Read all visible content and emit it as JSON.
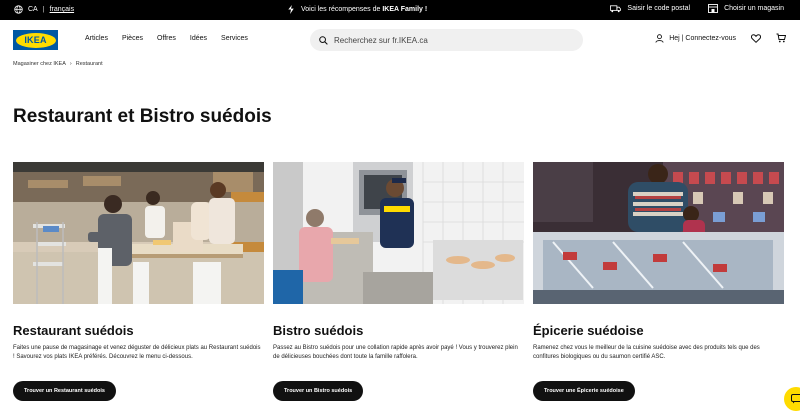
{
  "topbar": {
    "country": "CA",
    "language": "français",
    "promo_prefix": "Voici les récompenses de",
    "promo_brand": "IKEA Family !",
    "postal_label": "Saisir le code postal",
    "store_label": "Choisir un magasin"
  },
  "header": {
    "logo_text": "IKEA",
    "nav": [
      "Articles",
      "Pièces",
      "Offres",
      "Idées",
      "Services"
    ],
    "search_placeholder": "Recherchez sur fr.IKEA.ca",
    "account_label": "Hej | Connectez-vous"
  },
  "breadcrumb": [
    "Magasiner chez IKEA",
    "Restaurant"
  ],
  "page_title": "Restaurant et Bistro suédois",
  "cards": [
    {
      "title": "Restaurant suédois",
      "text": "Faites une pause de magasinage et venez déguster de délicieux plats au Restaurant suédois ! Savourez vos plats IKEA préférés. Découvrez le menu ci-dessous.",
      "button": "Trouver un Restaurant suédois"
    },
    {
      "title": "Bistro suédois",
      "text": "Passez au Bistro suédois pour une collation rapide après avoir payé ! Vous y trouverez plein de délicieuses bouchées dont toute la famille raffolera.",
      "button": "Trouver un Bistro suédois"
    },
    {
      "title": "Épicerie suédoise",
      "text": "Ramenez chez vous le meilleur de la cuisine suédoise avec des produits tels que des confitures biologiques ou du saumon certifié ASC.",
      "button": "Trouver une Épicerie suédoise"
    }
  ],
  "colors": {
    "brand_blue": "#0058a3",
    "brand_yellow": "#ffdb00",
    "topbar": "#000000",
    "button": "#111111"
  }
}
